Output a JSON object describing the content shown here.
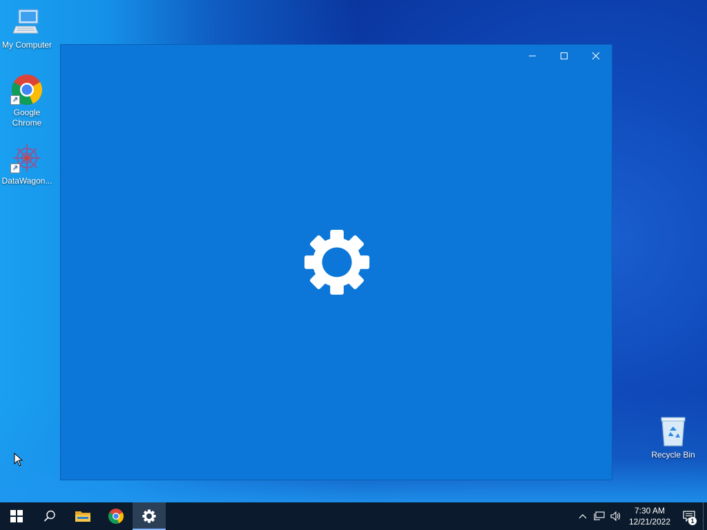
{
  "desktop": {
    "icons": [
      {
        "label": "My Computer",
        "icon": "computer-icon"
      },
      {
        "label": "Google Chrome",
        "icon": "chrome-icon"
      },
      {
        "label": "DataWagon...",
        "icon": "datawagon-icon"
      },
      {
        "label": "Recycle Bin",
        "icon": "recycle-bin-icon"
      }
    ]
  },
  "window": {
    "app": "Settings",
    "splash_icon": "gear-icon",
    "controls": {
      "minimize": "minimize-icon",
      "maximize": "maximize-icon",
      "close": "close-icon"
    }
  },
  "taskbar": {
    "buttons": [
      {
        "name": "start",
        "icon": "windows-logo-icon"
      },
      {
        "name": "search",
        "icon": "search-icon"
      },
      {
        "name": "file-explorer",
        "icon": "folder-icon"
      },
      {
        "name": "chrome",
        "icon": "chrome-icon"
      },
      {
        "name": "settings",
        "icon": "gear-icon",
        "active": true
      }
    ],
    "tray": {
      "time": "7:30 AM",
      "date": "12/21/2022",
      "notification_count": "1"
    }
  },
  "colors": {
    "window_bg": "#0c77d8",
    "taskbar_bg": "#0b1a2c",
    "active_indicator": "#7fb6ff"
  }
}
